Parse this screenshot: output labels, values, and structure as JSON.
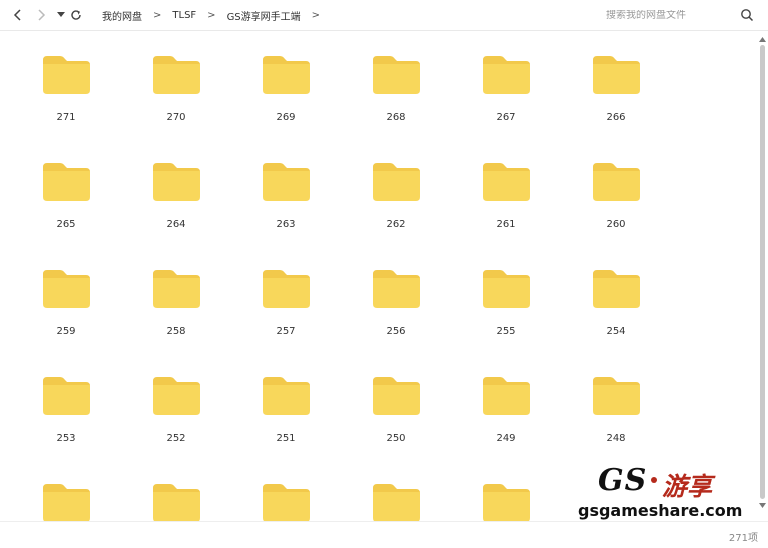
{
  "breadcrumb": [
    "我的网盘",
    "TLSF",
    "GS游享网手工端"
  ],
  "search": {
    "placeholder": "搜索我的网盘文件"
  },
  "folders": [
    "271",
    "270",
    "269",
    "268",
    "267",
    "266",
    "265",
    "264",
    "263",
    "262",
    "261",
    "260",
    "259",
    "258",
    "257",
    "256",
    "255",
    "254",
    "253",
    "252",
    "251",
    "250",
    "249",
    "248",
    "",
    "",
    "",
    "",
    ""
  ],
  "status": {
    "count": "271项"
  },
  "watermark": {
    "logo": "GS",
    "cn": "游享",
    "url": "gsgameshare.com"
  },
  "colors": {
    "folder": "#f8d75b",
    "folder_tab": "#f2c94b",
    "watermark_red": "#b52a1c"
  }
}
